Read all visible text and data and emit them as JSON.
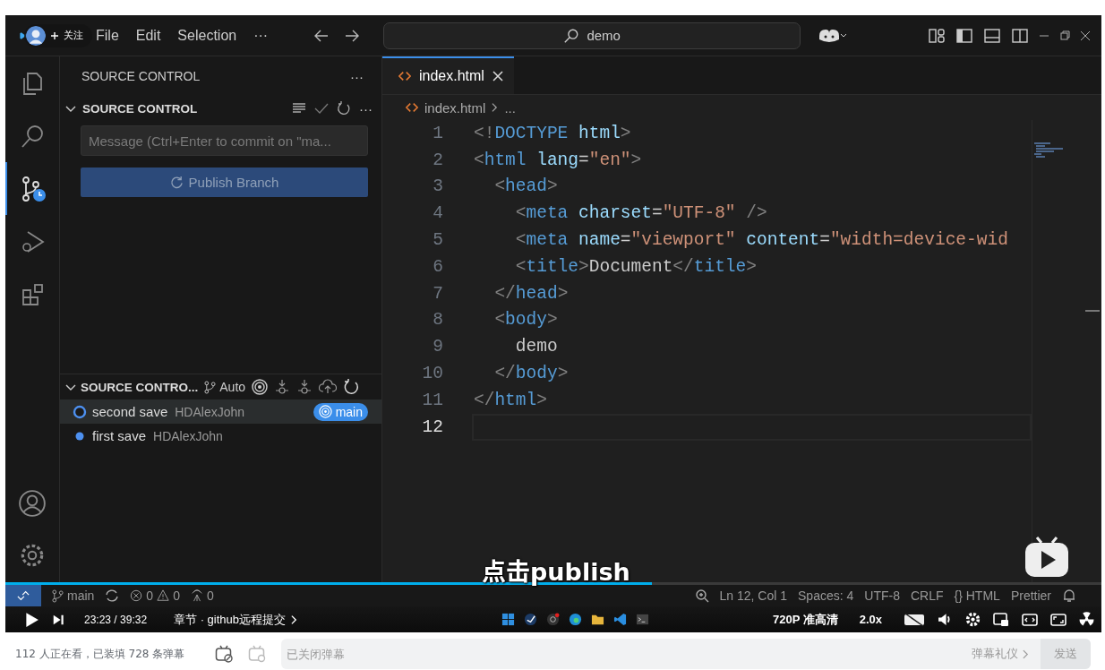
{
  "video": {
    "uploader_badge": {
      "label": "关注"
    },
    "title_bar": {
      "menus": [
        "File",
        "Edit",
        "Selection",
        "···"
      ],
      "search": "demo"
    },
    "activity_bar": [
      {
        "kind": "files",
        "selected": false
      },
      {
        "kind": "search",
        "selected": false
      },
      {
        "kind": "scm",
        "selected": true
      },
      {
        "kind": "debug",
        "selected": false
      },
      {
        "kind": "extensions",
        "selected": false
      }
    ],
    "sidebar": {
      "header": "SOURCE CONTROL",
      "header_more": "···",
      "section_title": "SOURCE CONTROL",
      "section_more": "···",
      "message_placeholder": "Message (Ctrl+Enter to commit on \"ma...",
      "publish_button": "Publish Branch",
      "graph_title": "SOURCE CONTRO...",
      "graph_mode": "Auto",
      "commits": [
        {
          "message": "second save",
          "author": "HDAlexJohn",
          "branch": "main",
          "selected": true
        },
        {
          "message": "first save",
          "author": "HDAlexJohn",
          "selected": false
        }
      ]
    },
    "editor": {
      "tab": "index.html",
      "breadcrumb": [
        "index.html",
        "..."
      ],
      "lines": [
        {
          "number": "1",
          "current": false,
          "tokens": [
            {
              "kind": "punct",
              "text": "<!"
            },
            {
              "kind": "tag",
              "text": "DOCTYPE"
            },
            {
              "kind": "attr",
              "text": " html"
            },
            {
              "kind": "punct",
              "text": ">"
            }
          ]
        },
        {
          "number": "2",
          "current": false,
          "tokens": [
            {
              "kind": "punct",
              "text": "<"
            },
            {
              "kind": "tag",
              "text": "html"
            },
            {
              "kind": "attr",
              "text": " lang"
            },
            {
              "kind": "plain",
              "text": "="
            },
            {
              "kind": "string",
              "text": "\"en\""
            },
            {
              "kind": "punct",
              "text": ">"
            }
          ]
        },
        {
          "number": "3",
          "current": false,
          "tokens": [
            {
              "kind": "punct",
              "text": "  <"
            },
            {
              "kind": "tag",
              "text": "head"
            },
            {
              "kind": "punct",
              "text": ">"
            }
          ]
        },
        {
          "number": "4",
          "current": false,
          "tokens": [
            {
              "kind": "punct",
              "text": "    <"
            },
            {
              "kind": "tag",
              "text": "meta"
            },
            {
              "kind": "attr",
              "text": " charset"
            },
            {
              "kind": "plain",
              "text": "="
            },
            {
              "kind": "string",
              "text": "\"UTF-8\""
            },
            {
              "kind": "punct",
              "text": " />"
            }
          ]
        },
        {
          "number": "5",
          "current": false,
          "tokens": [
            {
              "kind": "punct",
              "text": "    <"
            },
            {
              "kind": "tag",
              "text": "meta"
            },
            {
              "kind": "attr",
              "text": " name"
            },
            {
              "kind": "plain",
              "text": "="
            },
            {
              "kind": "string",
              "text": "\"viewport\""
            },
            {
              "kind": "attr",
              "text": " content"
            },
            {
              "kind": "plain",
              "text": "="
            },
            {
              "kind": "string",
              "text": "\"width=device-wid"
            }
          ]
        },
        {
          "number": "6",
          "current": false,
          "tokens": [
            {
              "kind": "punct",
              "text": "    <"
            },
            {
              "kind": "tag",
              "text": "title"
            },
            {
              "kind": "punct",
              "text": ">"
            },
            {
              "kind": "plain",
              "text": "Document"
            },
            {
              "kind": "punct",
              "text": "</"
            },
            {
              "kind": "tag",
              "text": "title"
            },
            {
              "kind": "punct",
              "text": ">"
            }
          ]
        },
        {
          "number": "7",
          "current": false,
          "tokens": [
            {
              "kind": "punct",
              "text": "  </"
            },
            {
              "kind": "tag",
              "text": "head"
            },
            {
              "kind": "punct",
              "text": ">"
            }
          ]
        },
        {
          "number": "8",
          "current": false,
          "tokens": [
            {
              "kind": "punct",
              "text": "  <"
            },
            {
              "kind": "tag",
              "text": "body"
            },
            {
              "kind": "punct",
              "text": ">"
            }
          ]
        },
        {
          "number": "9",
          "current": false,
          "tokens": [
            {
              "kind": "plain",
              "text": "    demo"
            }
          ]
        },
        {
          "number": "10",
          "current": false,
          "tokens": [
            {
              "kind": "punct",
              "text": "  </"
            },
            {
              "kind": "tag",
              "text": "body"
            },
            {
              "kind": "punct",
              "text": ">"
            }
          ]
        },
        {
          "number": "11",
          "current": false,
          "tokens": [
            {
              "kind": "punct",
              "text": "</"
            },
            {
              "kind": "tag",
              "text": "html"
            },
            {
              "kind": "punct",
              "text": ">"
            }
          ]
        },
        {
          "number": "12",
          "current": true
        }
      ]
    },
    "status_bar": {
      "branch": "main",
      "errors": "0",
      "warnings": "0",
      "ports": "0",
      "items": [
        "Ln 12, Col 1",
        "Spaces: 4",
        "UTF-8",
        "CRLF",
        "{} HTML",
        "Prettier"
      ]
    },
    "subtitle": "点击publish",
    "player": {
      "progress": {
        "level": 0.59
      },
      "time_current": "23:23",
      "time_separator": "/",
      "time_total": "39:32",
      "chapter": "章节 · github远程提交",
      "quality": "720P 准高清",
      "speed": "2.0x"
    }
  },
  "danmaku_bar": {
    "viewers": "112 人正在看，已装填 728 条弹幕",
    "placeholder": "已关闭弹幕",
    "etiquette": "弹幕礼仪",
    "send": "发送"
  }
}
